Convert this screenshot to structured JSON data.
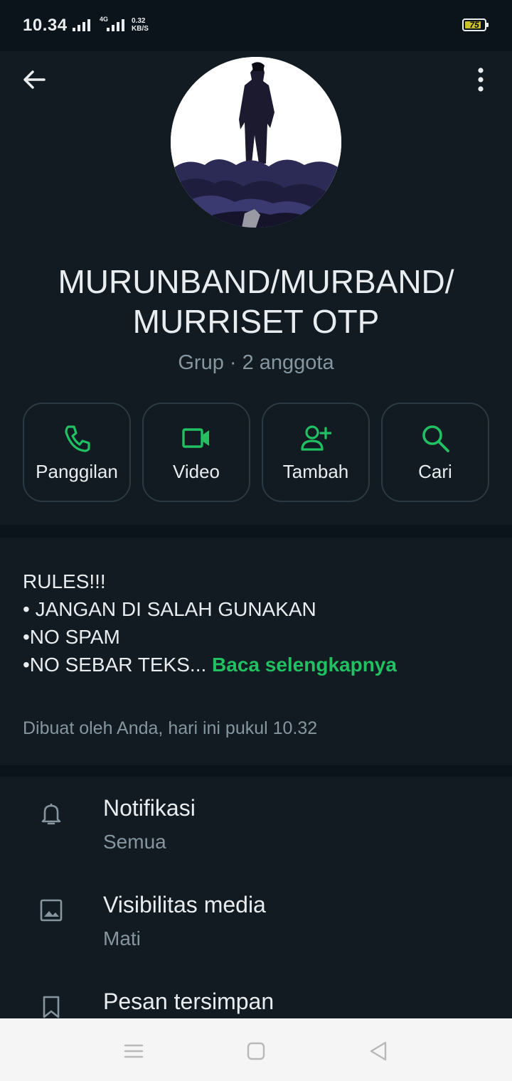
{
  "status_bar": {
    "time": "10.34",
    "network_label": "4G",
    "speed_value": "0.32",
    "speed_unit": "KB/S",
    "battery_level": "75",
    "battery_color": "#c9c22c"
  },
  "header": {
    "back_icon": "arrow-left-icon",
    "menu_icon": "more-vertical-icon",
    "group_name_line1": "MURUNBAND/MURBAND/",
    "group_name_line2": "MURRISET OTP",
    "subtitle": "Grup · 2 anggota"
  },
  "actions": [
    {
      "label": "Panggilan",
      "icon": "phone-icon"
    },
    {
      "label": "Video",
      "icon": "video-icon"
    },
    {
      "label": "Tambah",
      "icon": "add-person-icon"
    },
    {
      "label": "Cari",
      "icon": "search-icon"
    }
  ],
  "description": {
    "lines": [
      "RULES!!!",
      "",
      "• JANGAN DI SALAH GUNAKAN",
      "•NO SPAM",
      "•NO SEBAR TEKS..."
    ],
    "read_more": "Baca selengkapnya",
    "created": "Dibuat oleh Anda, hari ini pukul 10.32"
  },
  "settings": [
    {
      "title": "Notifikasi",
      "subtitle": "Semua",
      "icon": "bell-icon"
    },
    {
      "title": "Visibilitas media",
      "subtitle": "Mati",
      "icon": "image-icon"
    },
    {
      "title": "Pesan tersimpan",
      "subtitle": "",
      "icon": "bookmark-icon"
    }
  ],
  "theme": {
    "accent": "#21c063",
    "background": "#0b141a",
    "surface": "#111b21",
    "text_primary": "#e9edef",
    "text_secondary": "#8696a0"
  }
}
